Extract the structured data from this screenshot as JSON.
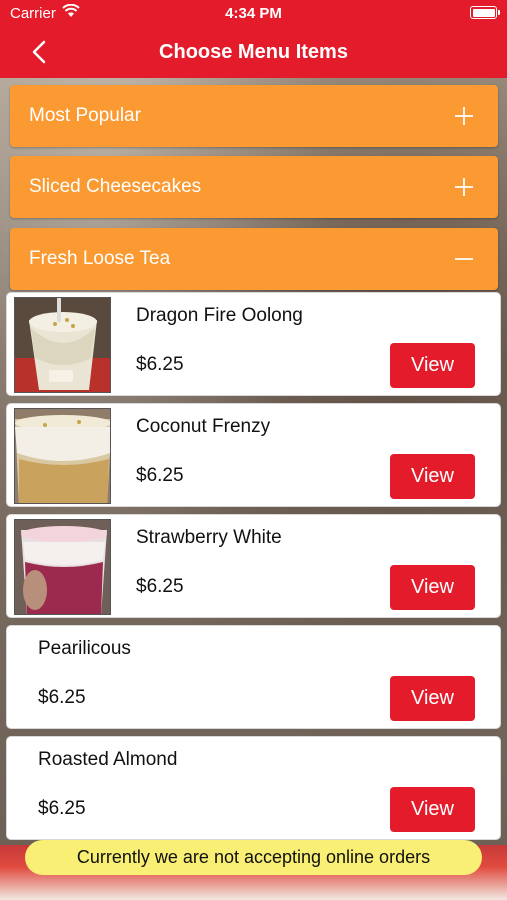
{
  "status_bar": {
    "carrier": "Carrier",
    "time": "4:34 PM"
  },
  "header": {
    "title": "Choose Menu Items",
    "color": "#e31b2b"
  },
  "categories": [
    {
      "label": "Most Popular",
      "icon": "plus-icon",
      "expanded": false
    },
    {
      "label": "Sliced Cheesecakes",
      "icon": "plus-icon",
      "expanded": false
    },
    {
      "label": "Fresh Loose Tea",
      "icon": "minus-icon",
      "expanded": true
    }
  ],
  "items": [
    {
      "name": "Dragon Fire Oolong",
      "price": "$6.25",
      "button": "View",
      "has_image": true
    },
    {
      "name": "Coconut Frenzy",
      "price": "$6.25",
      "button": "View",
      "has_image": true
    },
    {
      "name": "Strawberry White",
      "price": "$6.25",
      "button": "View",
      "has_image": true
    },
    {
      "name": "Pearilicous",
      "price": "$6.25",
      "button": "View",
      "has_image": false
    },
    {
      "name": "Roasted Almond",
      "price": "$6.25",
      "button": "View",
      "has_image": false
    }
  ],
  "notice": "Currently we are not accepting online orders",
  "colors": {
    "accent": "#e31b2b",
    "category": "#fb9a33",
    "notice": "#f8ef74"
  }
}
